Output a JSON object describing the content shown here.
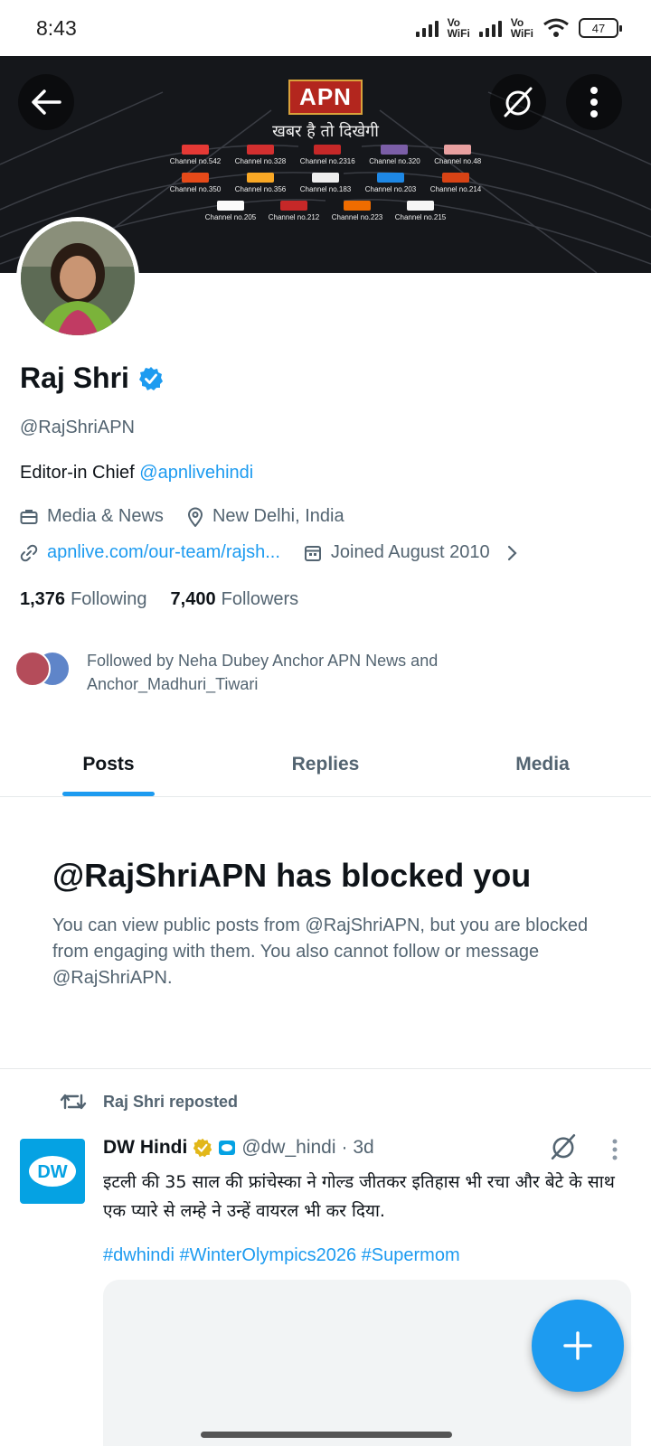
{
  "status_bar": {
    "time": "8:43",
    "vowifi_1": [
      "Vo",
      "WiFi"
    ],
    "vowifi_2": [
      "Vo",
      "WiFi"
    ],
    "battery": "47"
  },
  "banner": {
    "logo": "APN",
    "tagline": "खबर है तो दिखेगी",
    "channels_row1": [
      "Channel no.542",
      "Channel no.328",
      "Channel no.2316",
      "Channel no.320",
      "Channel no.48"
    ],
    "channels_row2": [
      "Channel no.350",
      "Channel no.356",
      "Channel no.183",
      "Channel no.203",
      "Channel no.214"
    ],
    "channels_row3": [
      "Channel no.205",
      "Channel no.212",
      "Channel no.223",
      "Channel no.215"
    ]
  },
  "profile": {
    "name": "Raj Shri",
    "handle": "@RajShriAPN",
    "bio_prefix": "Editor-in Chief ",
    "bio_link": "@apnlivehindi",
    "category": "Media & News",
    "location": "New Delhi, India",
    "website": "apnlive.com/our-team/rajsh...",
    "joined": "Joined August 2010",
    "following_count": "1,376",
    "following_label": "Following",
    "followers_count": "7,400",
    "followers_label": "Followers",
    "followed_by": "Followed by Neha Dubey Anchor APN News and Anchor_Madhuri_Tiwari"
  },
  "tabs": [
    "Posts",
    "Replies",
    "Media"
  ],
  "blocked": {
    "title": "@RajShriAPN has blocked you",
    "text": "You can view public posts from @RajShriAPN, but you are blocked from engaging with them. You also cannot follow or message @RajShriAPN."
  },
  "post": {
    "repost_label": "Raj Shri reposted",
    "author_name": "DW Hindi",
    "author_handle": "@dw_hindi",
    "time": "· 3d",
    "text": "इटली की 35 साल की फ्रांचेस्का ने गोल्ड जीतकर इतिहास भी रचा और बेटे के साथ एक प्यारे से लम्हे ने उन्हें वायरल भी कर दिया.",
    "hashtags": "#dwhindi #WinterOlympics2026 #Supermom",
    "avatar_text": "DW"
  },
  "colors": {
    "accent": "#1d9bf0",
    "text": "#0f1419",
    "secondary": "#536471",
    "gold_badge": "#e2b719"
  }
}
